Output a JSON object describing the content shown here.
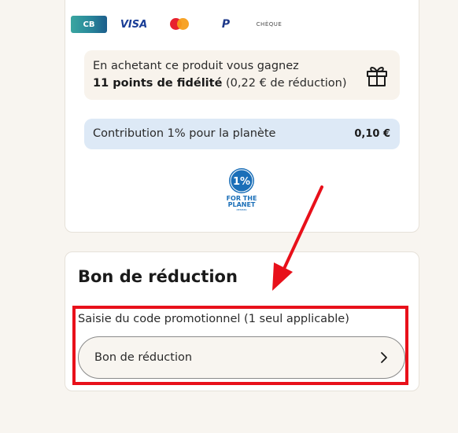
{
  "payment_methods": {
    "cb_label": "CB",
    "visa_label": "VISA",
    "paypal_label": "P",
    "cheque_label": "CHÈQUE"
  },
  "loyalty": {
    "line1": "En achetant ce produit vous gagnez",
    "points_bold": "11 points de fidélité",
    "reduction_text": " (0,22 € de réduction)"
  },
  "contribution": {
    "label": "Contribution 1% pour la planète",
    "value": "0,10 €"
  },
  "ftp_logo": {
    "percent": "1%",
    "line1": "FOR THE",
    "line2": "PLANET",
    "line3": "MEMBER"
  },
  "coupon": {
    "title": "Bon de réduction",
    "promo_label": "Saisie du code promotionnel (1 seul applicable)",
    "field_text": "Bon de réduction"
  },
  "colors": {
    "highlight": "#e8101a",
    "background": "#f8f5f0",
    "contribution_bg": "#dde9f6",
    "loyalty_bg": "#f8f3ec"
  }
}
